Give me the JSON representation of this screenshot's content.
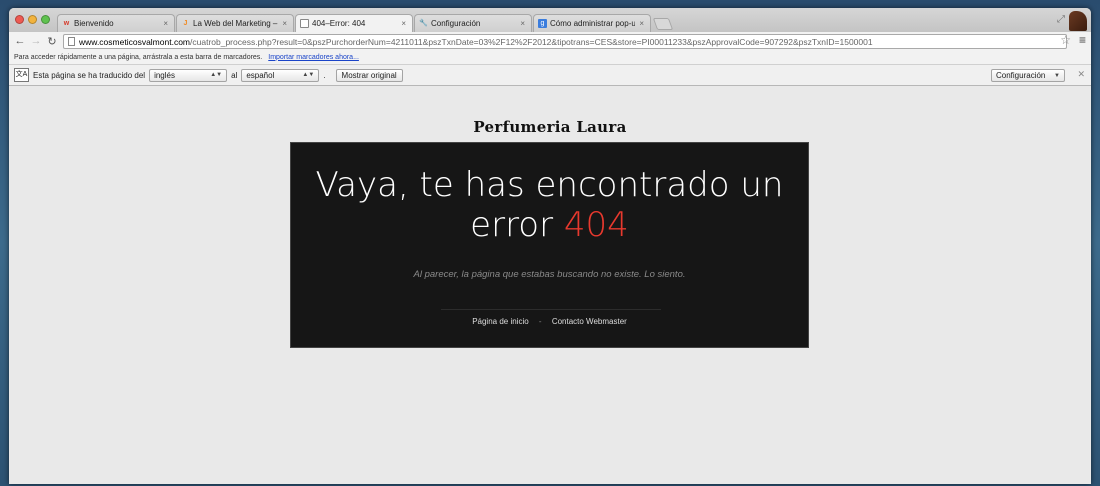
{
  "tabs": [
    {
      "label": "Bienvenido",
      "favicon": "w",
      "favicon_color": "#d63a2a"
    },
    {
      "label": "La Web del Marketing – Adm",
      "favicon": "J",
      "favicon_color": "#f08a24"
    },
    {
      "label": "404–Error: 404",
      "favicon": "",
      "favicon_color": "#ffffff"
    },
    {
      "label": "Configuración",
      "favicon": "🔧",
      "favicon_color": "#777777"
    },
    {
      "label": "Cómo administrar pop-ups",
      "favicon": "g",
      "favicon_color": "#3b7ddd"
    }
  ],
  "tab_close_glyph": "×",
  "url": {
    "host": "www.cosmeticosvalmont.com",
    "path": "/cuatrob_process.php?result=0&pszPurchorderNum=4211011&pszTxnDate=03%2F12%2F2012&tipotrans=CES&store=PI00011233&pszApprovalCode=907292&pszTxnID=1500001"
  },
  "bookmarks": {
    "hint": "Para acceder rápidamente a una página, arrástrala a esta barra de marcadores.",
    "import_link": "Importar marcadores ahora..."
  },
  "translate": {
    "prefix": "Esta página se ha traducido del",
    "from_lang": "inglés",
    "connector": "al",
    "to_lang": "español",
    "period": ".",
    "show_original": "Mostrar original",
    "settings": "Configuración"
  },
  "page": {
    "site_title": "Perfumeria Laura",
    "headline_line1": "Vaya, te has encontrado un",
    "headline_line2_prefix": "error",
    "headline_code": "404",
    "subtitle": "Al parecer, la página que estabas buscando no existe. Lo siento.",
    "link_home": "Página de inicio",
    "link_separator": "-",
    "link_contact": "Contacto Webmaster"
  },
  "colors": {
    "error_code": "#e8392e",
    "error_box_bg": "#161616",
    "link_blue": "#1a44c8"
  },
  "icons": {
    "back": "←",
    "forward": "→",
    "reload": "↻",
    "star": "☆",
    "menu": "≡",
    "close": "✕",
    "restore": "⤢"
  }
}
